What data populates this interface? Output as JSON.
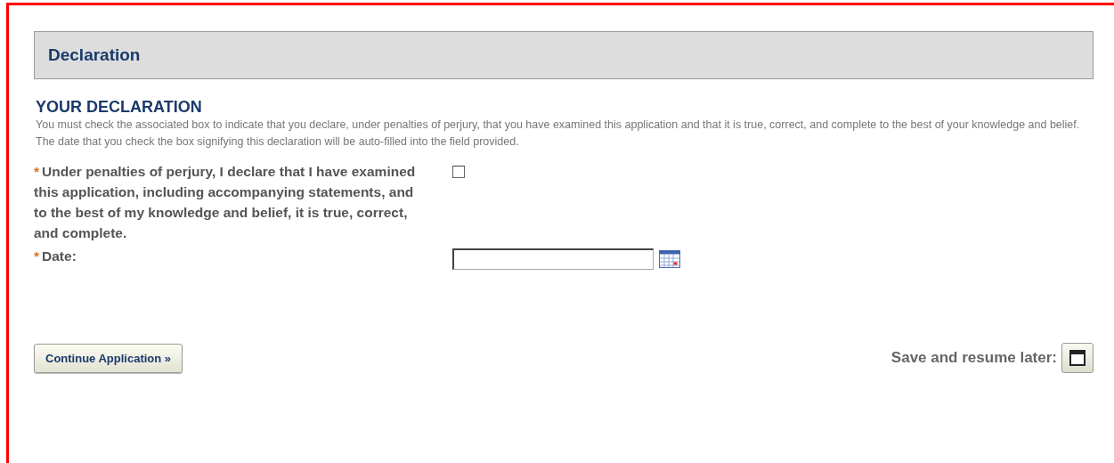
{
  "section_header": {
    "title": "Declaration"
  },
  "declaration": {
    "heading": "YOUR DECLARATION",
    "instructions": "You must check the associated box to indicate that you declare, under penalties of perjury, that you have examined this application and that it is true, correct, and complete to the best of your knowledge and belief. The date that you check the box signifying this declaration will be auto-filled into the field provided."
  },
  "fields": [
    {
      "kind": "checkbox",
      "required_marker": "*",
      "label": "Under penalties of perjury, I declare that I have examined this application, including accompanying statements, and to the best of my knowledge and belief, it is true, correct, and complete.",
      "checked": false
    },
    {
      "kind": "date",
      "required_marker": "*",
      "label": "Date:"
    }
  ],
  "footer": {
    "continue_button": "Continue Application »",
    "save_label": "Save and resume later:"
  }
}
